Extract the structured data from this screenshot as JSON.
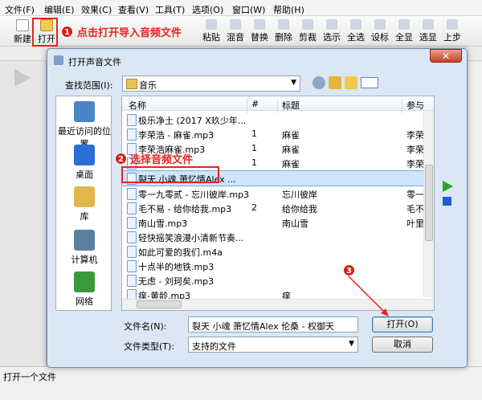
{
  "menu": [
    "文件(F)",
    "编辑(E)",
    "效果(C)",
    "查看(V)",
    "工具(T)",
    "选项(O)",
    "窗口(W)",
    "帮助(H)"
  ],
  "toolbar": {
    "new_label": "新建",
    "open_label": "打开",
    "items": [
      "粘贴",
      "混音",
      "替换",
      "删除",
      "剪裁",
      "选示",
      "全选",
      "设标",
      "全显",
      "选显",
      "上步"
    ]
  },
  "status": {
    "text": "打开一个文件"
  },
  "dialog": {
    "title": "打开声音文件",
    "close_label": "✕",
    "lookin_label": "查找范围(I):",
    "lookin_value": "音乐",
    "places": [
      {
        "label": "最近访问的位置",
        "icon": "recent-places-icon",
        "color": "#4a86c5"
      },
      {
        "label": "桌面",
        "icon": "desktop-icon",
        "color": "#2a6fd6"
      },
      {
        "label": "库",
        "icon": "libraries-icon",
        "color": "#e2b84a"
      },
      {
        "label": "计算机",
        "icon": "computer-icon",
        "color": "#5d7f9f"
      },
      {
        "label": "网络",
        "icon": "network-icon",
        "color": "#3a9a3a"
      }
    ],
    "columns": {
      "name": "名称",
      "number": "#",
      "title": "标题",
      "artist": "参与"
    },
    "rows": [
      {
        "name": "极乐净土 (2017 X玖少年...",
        "number": "",
        "title": "",
        "artist": ""
      },
      {
        "name": "李荣浩 - 麻雀.mp3",
        "number": "1",
        "title": "麻雀",
        "artist": "李荣"
      },
      {
        "name": "李荣浩麻雀.mp3",
        "number": "1",
        "title": "麻雀",
        "artist": "李荣"
      },
      {
        "name": "",
        "number": "1",
        "title": "麻雀",
        "artist": "李荣"
      },
      {
        "name": "裂天 小魂 萧忆情Alex ...",
        "number": "",
        "title": "",
        "artist": ""
      },
      {
        "name": "零一九零贰 - 忘川彼岸.mp3",
        "number": "",
        "title": "忘川彼岸",
        "artist": "零一"
      },
      {
        "name": "毛不易 - 给你给我.mp3",
        "number": "2",
        "title": "给你给我",
        "artist": "毛不"
      },
      {
        "name": "南山雪.mp3",
        "number": "",
        "title": "南山雪",
        "artist": "叶里"
      },
      {
        "name": "轻快摇笑浪漫小清新节奏...",
        "number": "",
        "title": "",
        "artist": ""
      },
      {
        "name": "如此可爱的我们.m4a",
        "number": "",
        "title": "",
        "artist": ""
      },
      {
        "name": "十点半的地铁.mp3",
        "number": "",
        "title": "",
        "artist": ""
      },
      {
        "name": "无虑 - 刘珂矣.mp3",
        "number": "",
        "title": "",
        "artist": ""
      },
      {
        "name": "痒-黄龄.mp3",
        "number": "",
        "title": "痒",
        "artist": ""
      }
    ],
    "filename_label": "文件名(N):",
    "filename_value": "裂天 小魂 萧忆情Alex 伦桑 - 权御天",
    "filetype_label": "文件类型(T):",
    "filetype_value": "支持的文件",
    "open_button": "打开(O)",
    "cancel_button": "取消"
  },
  "annotations": {
    "step1_num": "1",
    "step1_text": "点击打开导入音频文件",
    "step2_num": "2",
    "step2_text": "选择音频文件",
    "step3_num": "3"
  },
  "colors": {
    "annotation_red": "#e8231e",
    "selection": "#cfe3fb",
    "dialog_bg": "#dbe7f4"
  }
}
